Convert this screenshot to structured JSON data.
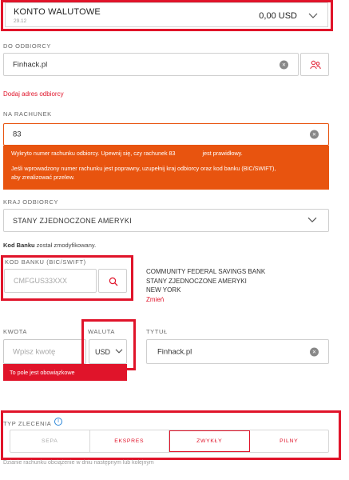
{
  "account": {
    "title": "KONTO WALUTOWE",
    "date": "29.12",
    "balance": "0,00 USD"
  },
  "recipient": {
    "label": "DO ODBIORCY",
    "value": "Finhack.pl",
    "add_link": "Dodaj adres odbiorcy"
  },
  "account_number": {
    "label": "NA RACHUNEK",
    "value": "83"
  },
  "error_box": {
    "line1_a": "Wykryto numer rachunku odbiorcy. Upewnij się, czy rachunek 83",
    "line1_b": "jest prawidłowy.",
    "line2": "Jeśli wprowadzony numer rachunku jest poprawny, uzupełnij kraj odbiorcy oraz kod banku (BIC/SWIFT),",
    "line3": "aby zrealizować przelew."
  },
  "country": {
    "label": "KRAJ ODBIORCY",
    "value": "STANY ZJEDNOCZONE AMERYKI"
  },
  "bank_code_note": {
    "bold": "Kod Banku",
    "rest": " został zmodyfikowany."
  },
  "bank_code": {
    "label": "KOD BANKU (BIC/SWIFT)",
    "placeholder": "CMFGUS33XXX"
  },
  "bank_info": {
    "name": "COMMUNITY FEDERAL SAVINGS BANK",
    "country": "STANY ZJEDNOCZONE AMERYKI",
    "city": "NEW YORK",
    "change_link": "Zmień"
  },
  "amount": {
    "label": "KWOTA",
    "placeholder": "Wpisz kwotę",
    "error": "To pole jest obowiązkowe"
  },
  "currency": {
    "label": "WALUTA",
    "value": "USD"
  },
  "title_field": {
    "label": "TYTUŁ",
    "value": "Finhack.pl"
  },
  "order_type": {
    "label": "TYP ZLECENIA",
    "info_icon": "i",
    "tabs": [
      {
        "label": "SEPA",
        "state": "disabled"
      },
      {
        "label": "EKSPRES",
        "state": "normal"
      },
      {
        "label": "ZWYKŁY",
        "state": "active"
      },
      {
        "label": "PILNY",
        "state": "normal"
      }
    ]
  },
  "footer_note": "Dzianie rachunku obciążenie w dniu następnym lub kolejnym",
  "colors": {
    "accent": "#e0142a",
    "error_bg": "#e8540f"
  }
}
